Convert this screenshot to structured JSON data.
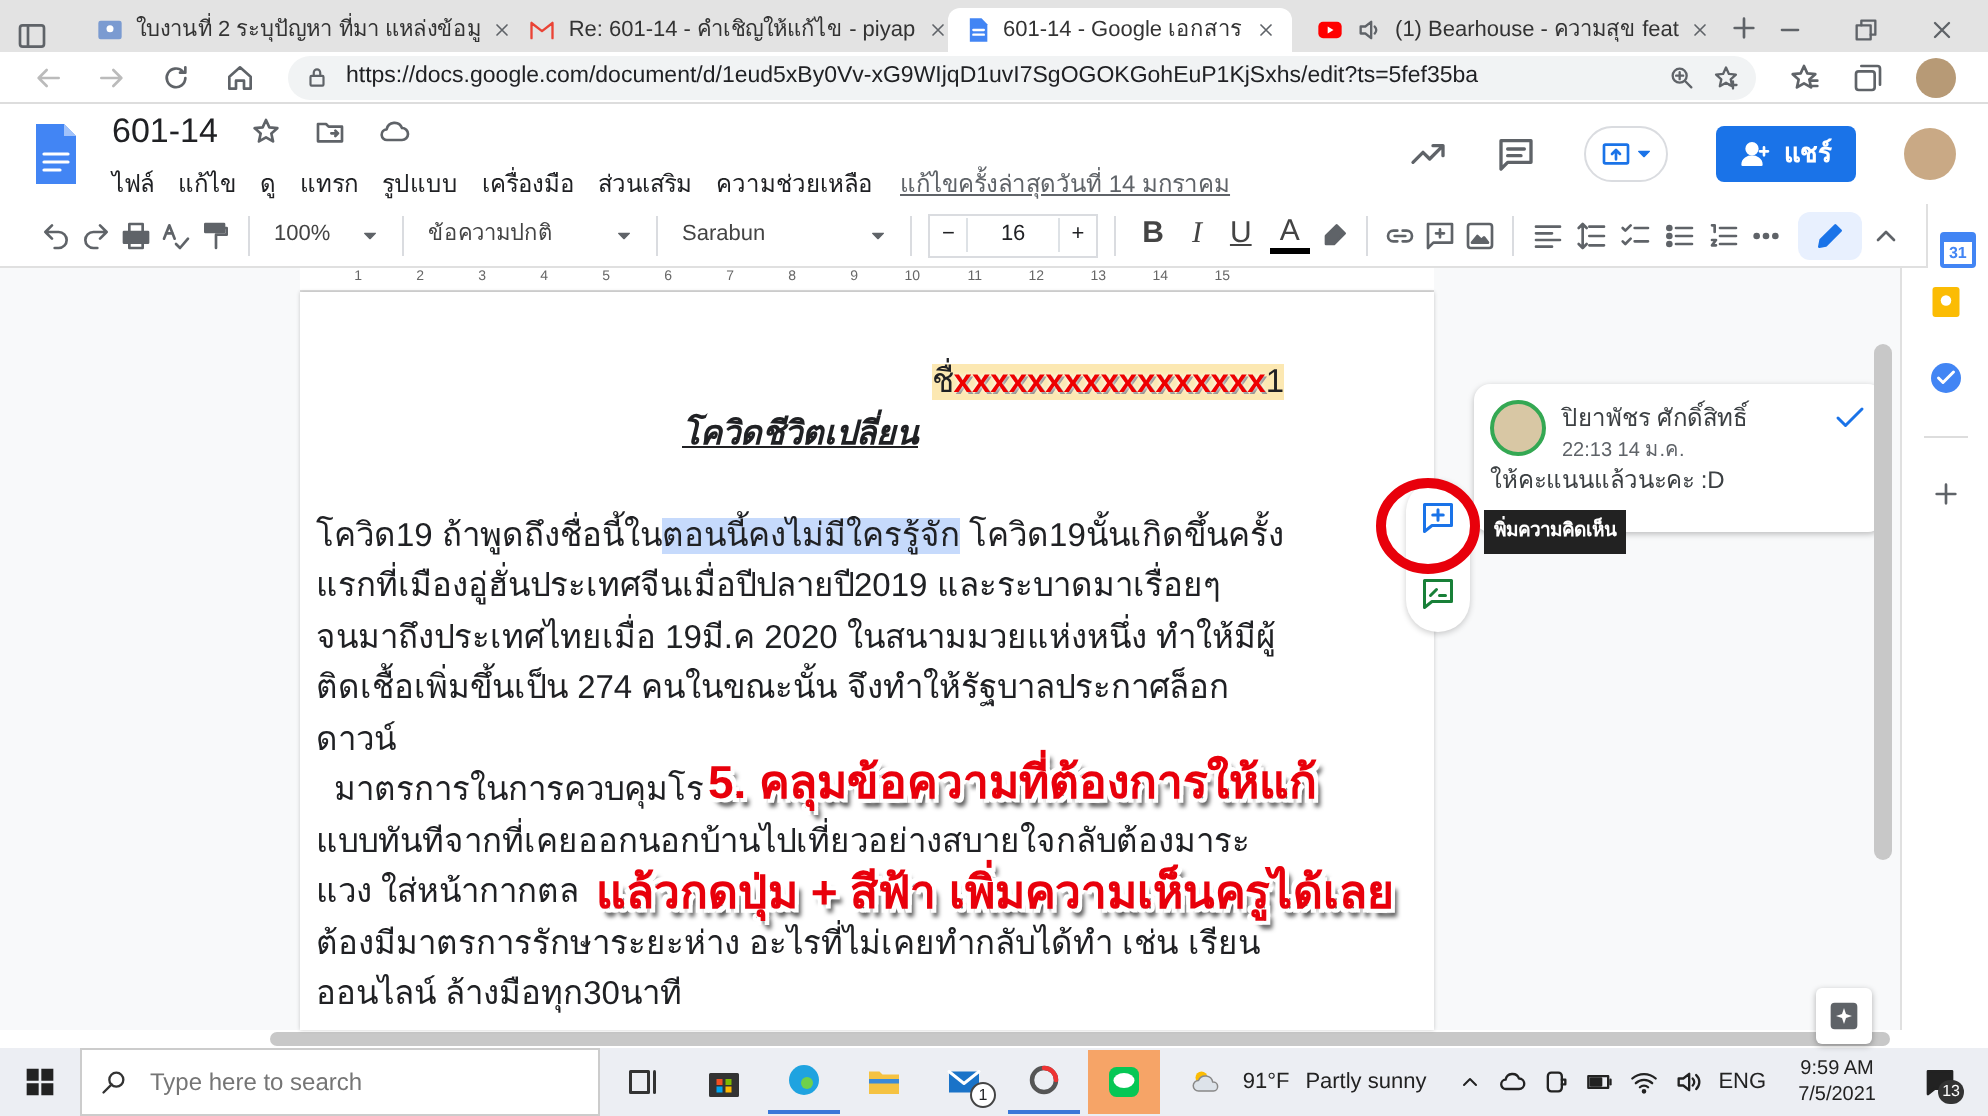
{
  "browser": {
    "tabs": [
      {
        "kind": "classroom",
        "title": "ใบงานที่ 2 ระบุปัญหา ที่มา แหล่งข้อมู",
        "selected": false
      },
      {
        "kind": "mail",
        "title": "Re: 601-14 - คำเชิญให้แก้ไข - piyap",
        "selected": false
      },
      {
        "kind": "docs",
        "title": "601-14 - Google เอกสาร",
        "selected": true
      },
      {
        "kind": "video",
        "title": "(1) Bearhouse - ความสุข feat",
        "selected": false
      }
    ],
    "url": "https://docs.google.com/document/d/1eud5xBy0Vv-xG9WIjqD1uvI7SgOGOKGohEuP1KjSxhs/edit?ts=5fef35ba"
  },
  "docs": {
    "title": "601-14",
    "menus": [
      "ไฟล์",
      "แก้ไข",
      "ดู",
      "แทรก",
      "รูปแบบ",
      "เครื่องมือ",
      "ส่วนเสริม",
      "ความช่วยเหลือ"
    ],
    "last_edit": "แก้ไขครั้งล่าสุดวันที่ 14 มกราคม",
    "share": "แชร์"
  },
  "toolbar": {
    "zoom": "100%",
    "style": "ข้อความปกติ",
    "font": "Sarabun",
    "minus": "−",
    "font_size": "16",
    "plus": "+",
    "bold": "B",
    "italic": "I",
    "underline": "U",
    "text_color": "A"
  },
  "ruler": [
    "1",
    "2",
    "3",
    "4",
    "5",
    "6",
    "7",
    "8",
    "9",
    "10",
    "11",
    "12",
    "13",
    "14",
    "15"
  ],
  "document": {
    "name_line": {
      "prefix": "ชื่",
      "redacted": "xxxxxxxxxxxxxxxxx",
      "suffix": "1"
    },
    "title": "โควิดชีวิตเปลี่ยน",
    "lines": [
      [
        {
          "text": "โควิด19 ถ้าพูดถึงชื่อนี้ใน",
          "selected": false
        },
        {
          "text": "ตอนนี้คงไม่มีใครรู้จัก",
          "selected": true
        },
        {
          "text": " โควิด19นั้นเกิดขึ้นครั้ง",
          "selected": false
        }
      ],
      [
        {
          "text": "แรกที่เมืองอู่ฮั่นประเทศจีนเมื่อปีปลายปี2019 และระบาดมาเรื่อยๆ",
          "selected": false
        }
      ],
      [
        {
          "text": "จนมาถึงประเทศไทยเมื่อ 19มี.ค 2020 ในสนามมวยแห่งหนึ่ง ทำให้มีผู้",
          "selected": false
        }
      ],
      [
        {
          "text": "ติดเชื้อเพิ่มขึ้นเป็น 274 คนในขณะนั้น จึงทำให้รัฐบาลประกาศล็อก",
          "selected": false
        }
      ],
      [
        {
          "text": "ดาวน์",
          "selected": false
        }
      ],
      [
        {
          "text": "  มาตรการในการควบคุมโร",
          "selected": false
        }
      ],
      [
        {
          "text": "แบบทันทีจากที่เคยออกนอกบ้านไปเที่ยวอย่างสบายใจกลับต้องมาระ",
          "selected": false
        }
      ],
      [
        {
          "text": "แวง ใส่หน้ากากตล",
          "selected": false
        }
      ],
      [
        {
          "text": "ต้องมีมาตรการรักษาระยะห่าง อะไรที่ไม่เคยทำกลับได้ทำ เช่น เรียน",
          "selected": false
        }
      ],
      [
        {
          "text": "ออนไลน์ ล้างมือทุก30นาที",
          "selected": false
        }
      ]
    ]
  },
  "annotation": [
    "5. คลุมข้อความที่ต้องการให้แก้",
    "แล้วกดปุ่ม + สีฟ้า เพิ่มความเห็นครูได้เลย"
  ],
  "comment": {
    "author": "ปิยาพัชร ศักดิ์สิทธิ์",
    "time": "22:13 14 ม.ค.",
    "text": "ให้คะแนนแล้วนะคะ :D"
  },
  "tooltip": "พิ่มความคิดเห็น",
  "side_panel": {
    "calendar": "31"
  },
  "taskbar": {
    "search_placeholder": "Type here to search",
    "apps": [
      {
        "kind": "taskview",
        "running": false,
        "highlighted": false
      },
      {
        "kind": "store",
        "running": false,
        "highlighted": false
      },
      {
        "kind": "edge",
        "running": true,
        "highlighted": false
      },
      {
        "kind": "explorer",
        "running": false,
        "highlighted": false
      },
      {
        "kind": "mail",
        "running": false,
        "highlighted": false
      },
      {
        "kind": "app",
        "running": true,
        "highlighted": false
      },
      {
        "kind": "chat",
        "running": false,
        "highlighted": true
      }
    ],
    "mail_badge": "1",
    "temperature": "91°F",
    "weather": "Partly sunny",
    "language": "ENG",
    "time": "9:59 AM",
    "date": "7/5/2021",
    "notifications": "13"
  }
}
